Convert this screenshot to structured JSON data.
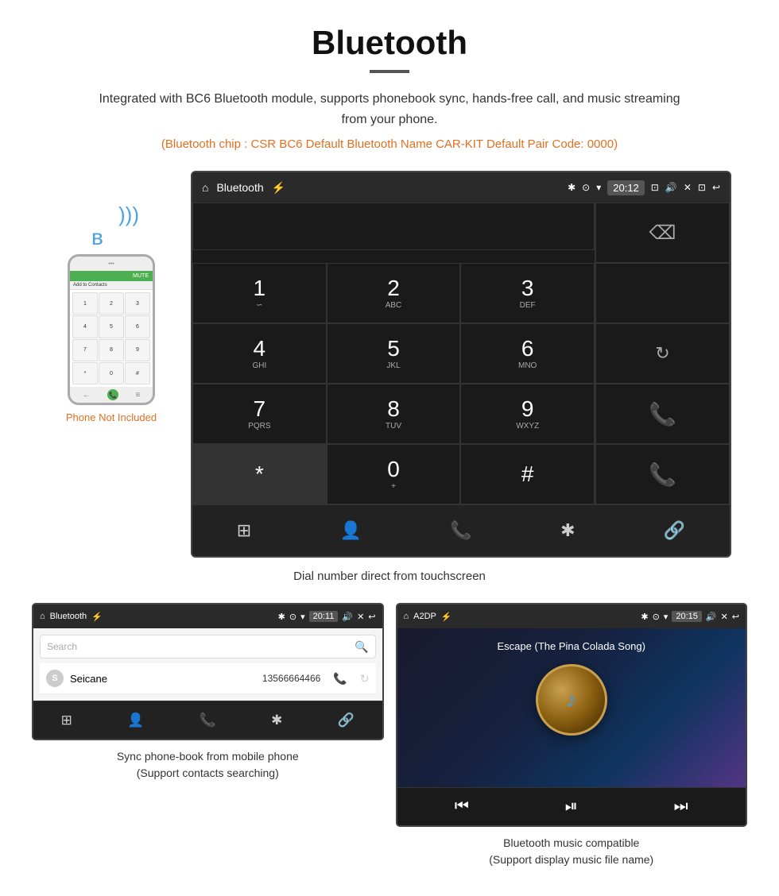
{
  "page": {
    "title": "Bluetooth",
    "divider": true,
    "description": "Integrated with BC6 Bluetooth module, supports phonebook sync, hands-free call, and music streaming from your phone.",
    "specs": "(Bluetooth chip : CSR BC6   Default Bluetooth Name CAR-KIT    Default Pair Code: 0000)",
    "dial_caption": "Dial number direct from touchscreen",
    "phonebook_caption": "Sync phone-book from mobile phone\n(Support contacts searching)",
    "music_caption": "Bluetooth music compatible\n(Support display music file name)",
    "phone_not_included": "Phone Not Included"
  },
  "main_screen": {
    "status_bar": {
      "home_icon": "⌂",
      "title": "Bluetooth",
      "usb_icon": "⚡",
      "bt_icon": "✱",
      "location_icon": "⊙",
      "signal_icon": "▾",
      "time": "20:12",
      "camera_icon": "📷",
      "volume_icon": "🔊",
      "close_icon": "✕",
      "window_icon": "⊡",
      "back_icon": "↩"
    },
    "dialpad": {
      "keys": [
        {
          "num": "1",
          "letters": "∞"
        },
        {
          "num": "2",
          "letters": "ABC"
        },
        {
          "num": "3",
          "letters": "DEF"
        },
        {
          "num": "4",
          "letters": "GHI"
        },
        {
          "num": "5",
          "letters": "JKL"
        },
        {
          "num": "6",
          "letters": "MNO"
        },
        {
          "num": "7",
          "letters": "PQRS"
        },
        {
          "num": "8",
          "letters": "TUV"
        },
        {
          "num": "9",
          "letters": "WXYZ"
        },
        {
          "num": "*",
          "letters": ""
        },
        {
          "num": "0",
          "letters": "+"
        },
        {
          "num": "#",
          "letters": ""
        }
      ]
    },
    "bottom_nav_icons": [
      "⊞",
      "👤",
      "📞",
      "✱",
      "🔗"
    ]
  },
  "phonebook_screen": {
    "status_bar": {
      "title": "Bluetooth",
      "time": "20:11"
    },
    "search_placeholder": "Search",
    "contacts": [
      {
        "letter": "S",
        "name": "Seicane",
        "phone": "13566664466"
      }
    ]
  },
  "music_screen": {
    "status_bar": {
      "title": "A2DP",
      "time": "20:15"
    },
    "song_title": "Escape (The Pina Colada Song)",
    "controls": {
      "prev": "⏮",
      "play_pause": "⏯",
      "next": "⏭"
    }
  }
}
